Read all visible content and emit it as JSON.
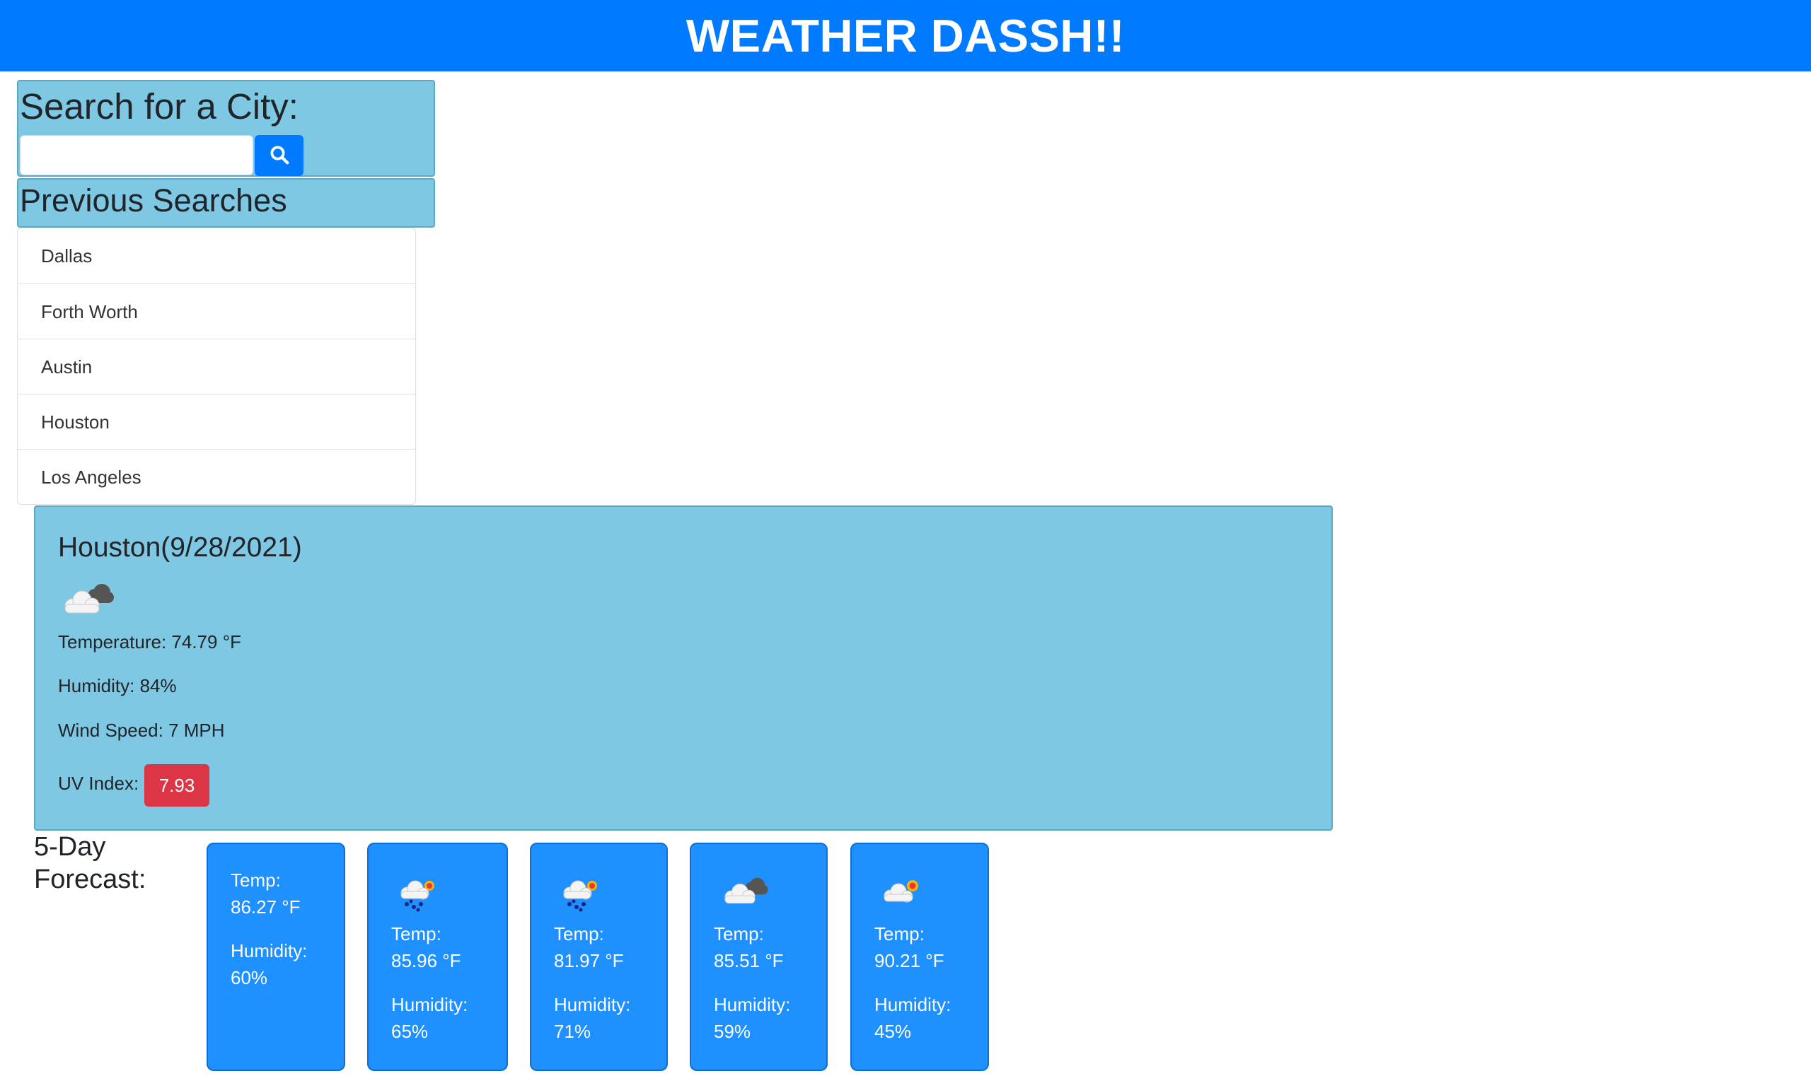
{
  "header": {
    "title": "WEATHER DASSH!!"
  },
  "search": {
    "heading": "Search for a City:",
    "input_value": "",
    "placeholder": ""
  },
  "previous": {
    "heading": "Previous Searches",
    "cities": [
      "Dallas",
      "Forth Worth",
      "Austin",
      "Houston",
      "Los Angeles"
    ]
  },
  "current": {
    "city_date": "Houston(9/28/2021)",
    "icon": "cloudy-icon",
    "temperature": "Temperature: 74.79 °F",
    "humidity": "Humidity: 84%",
    "wind": "Wind Speed: 7 MPH",
    "uv_label": "UV Index:",
    "uv_value": "7.93",
    "uv_color": "#dc3545"
  },
  "forecast": {
    "label_line1": "5-Day",
    "label_line2": "Forecast:",
    "days": [
      {
        "icon": "none",
        "temp_label": "Temp:",
        "temp": "86.27 °F",
        "hum_label": "Humidity:",
        "humidity": "60%"
      },
      {
        "icon": "rain-sun-icon",
        "temp_label": "Temp:",
        "temp": "85.96 °F",
        "hum_label": "Humidity:",
        "humidity": "65%"
      },
      {
        "icon": "rain-sun-icon",
        "temp_label": "Temp:",
        "temp": "81.97 °F",
        "hum_label": "Humidity:",
        "humidity": "71%"
      },
      {
        "icon": "cloudy-icon",
        "temp_label": "Temp:",
        "temp": "85.51 °F",
        "hum_label": "Humidity:",
        "humidity": "59%"
      },
      {
        "icon": "partly-cloudy-icon",
        "temp_label": "Temp:",
        "temp": "90.21 °F",
        "hum_label": "Humidity:",
        "humidity": "45%"
      }
    ]
  },
  "colors": {
    "primary": "#007bff",
    "panel": "#7ec8e3",
    "card": "#1e90ff",
    "danger": "#dc3545"
  }
}
